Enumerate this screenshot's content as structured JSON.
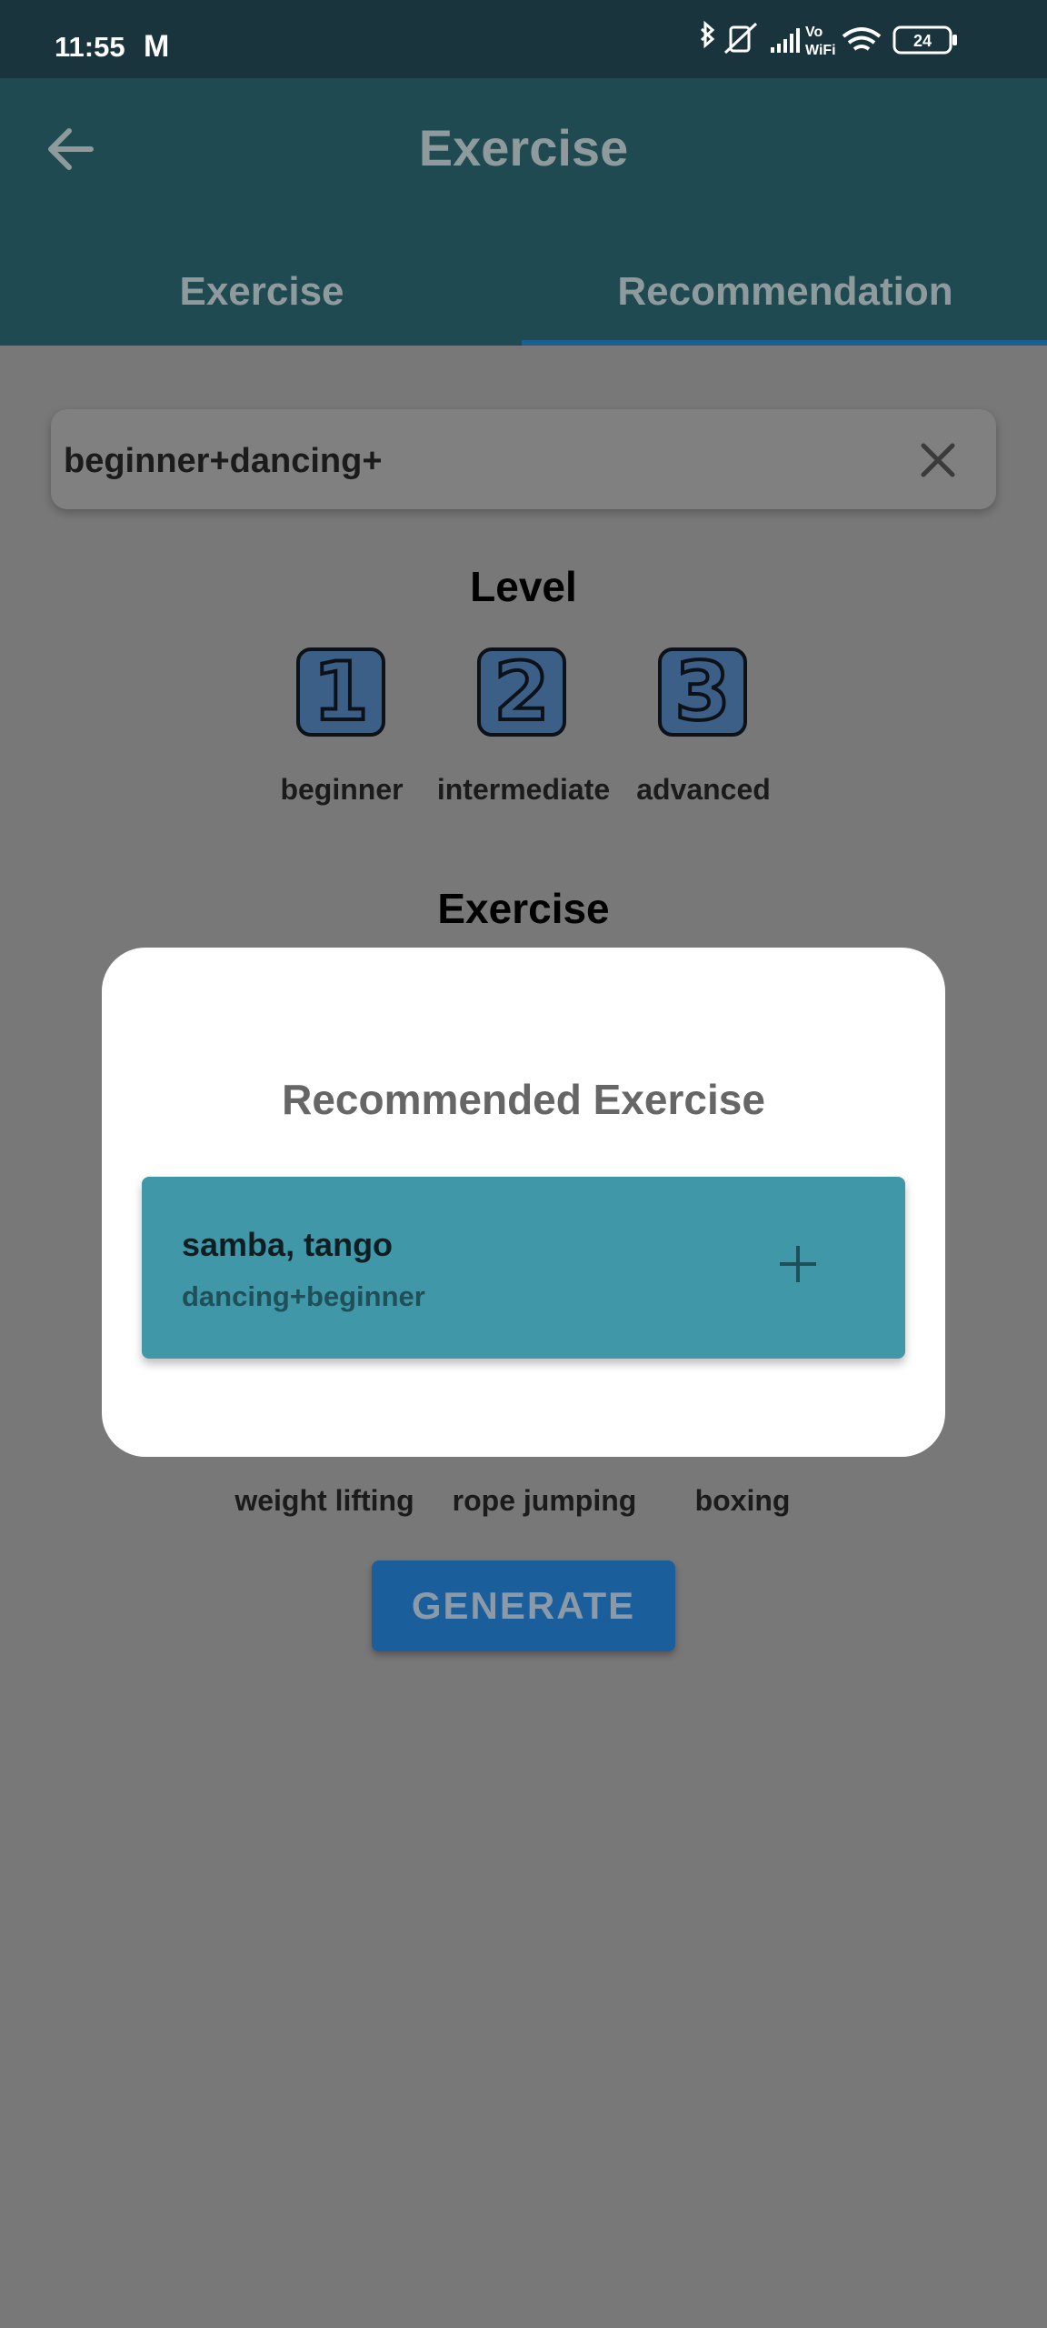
{
  "status_bar": {
    "time": "11:55",
    "notification_icon_text": "M",
    "battery": "24",
    "wifi_label": "Vo WiFi"
  },
  "app_bar": {
    "title": "Exercise",
    "tabs": [
      {
        "label": "Exercise",
        "selected": false
      },
      {
        "label": "Recommendation",
        "selected": true
      }
    ]
  },
  "search": {
    "value": "beginner+dancing+"
  },
  "level_section": {
    "heading": "Level",
    "levels": [
      {
        "number": "1",
        "label": "beginner"
      },
      {
        "number": "2",
        "label": "intermediate"
      },
      {
        "number": "3",
        "label": "advanced"
      }
    ]
  },
  "exercise_section": {
    "heading": "Exercise",
    "options": [
      "weight lifting",
      "rope jumping",
      "boxing"
    ]
  },
  "generate_label": "GENERATE",
  "dialog": {
    "title": "Recommended Exercise",
    "card": {
      "title": "samba, tango",
      "subtitle": "dancing+beginner"
    }
  },
  "colors": {
    "app_bar": "#1f4a52",
    "status_bar": "#19343c",
    "card": "#4097a8",
    "button": "#1a5f9c",
    "scrim_background": "#787878"
  }
}
